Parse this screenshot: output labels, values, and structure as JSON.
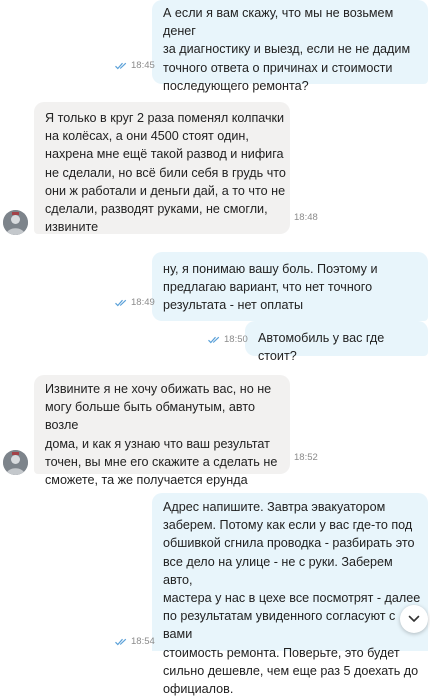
{
  "messages": [
    {
      "direction": "outgoing",
      "text": "А если я вам скажу, что мы не возьмем денег\nза диагностику и выезд, если не не дадим\nточного ответа о причинах и стоимости\nпоследующего ремонта?",
      "time": "18:45",
      "read": true
    },
    {
      "direction": "incoming",
      "text": "Я только в круг 2 раза поменял колпачки\nна колёсах, а они 4500 стоят один,\nнахрена мне ещё такой развод и нифига\nне сделали, но всё били себя в грудь что\nони ж работали и деньги дай, а то что не\nсделали, разводят руками, не смогли,\nизвините",
      "time": "18:48"
    },
    {
      "direction": "outgoing",
      "text": "ну, я понимаю вашу боль. Поэтому и\nпредлагаю вариант, что нет точного\nрезультата - нет оплаты",
      "time": "18:49",
      "read": true
    },
    {
      "direction": "outgoing",
      "text": "Автомобиль у вас где стоит?",
      "time": "18:50",
      "read": true
    },
    {
      "direction": "incoming",
      "text": "Извините я не хочу обижать вас, но не\nмогу больше быть обманутым, авто возле\nдома, и как я узнаю что ваш результат\nточен, вы мне его скажите а сделать не\nсможете, та же получается ерунда",
      "time": "18:52"
    },
    {
      "direction": "outgoing",
      "text": "Адрес напишите. Завтра эвакуатором\nзаберем. Потому как если у вас где-то под\nобшивкой сгнила проводка - разбирать это\nвсе дело на улице - не с руки.  Заберем авто,\nмастера у нас в цехе все посмотрят - далее\nпо результатам увиденного согласуют с вами\nстоимость ремонта. Поверьте, это будет\nсильно дешевле, чем еще раз 5 доехать до\nофициалов.",
      "time": "18:54",
      "read": true
    }
  ],
  "colors": {
    "outgoing_bubble": "#e8f5fb",
    "incoming_bubble": "#f2f1f0",
    "read_ticks": "#5aa0d8",
    "time_text": "#8b8b8b"
  },
  "icons": {
    "read_ticks": "double-check-icon",
    "scroll_down": "chevron-down-icon",
    "avatar": "user-avatar"
  }
}
